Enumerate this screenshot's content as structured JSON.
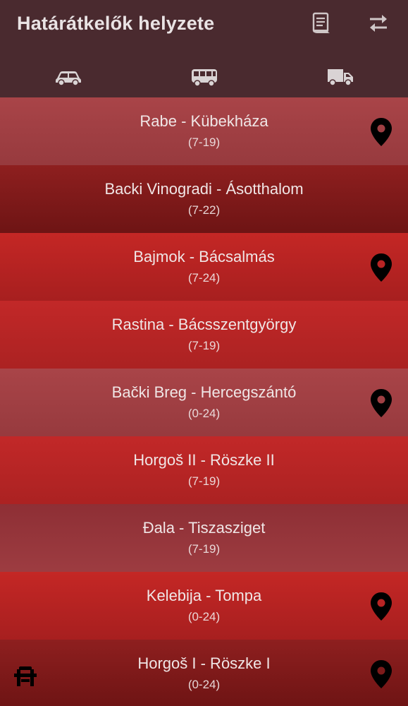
{
  "app": {
    "title": "Határátkelők helyzete"
  },
  "toolbar": {
    "icons": [
      "document-icon",
      "swap-icon"
    ]
  },
  "tabs": [
    {
      "icon": "car-icon"
    },
    {
      "icon": "bus-icon"
    },
    {
      "icon": "truck-icon"
    }
  ],
  "crossings": [
    {
      "name": "Rabe - Kübekháza",
      "hours": "(7-19)",
      "pin": true,
      "style": "g-light"
    },
    {
      "name": "Backi Vinogradi - Ásotthalom",
      "hours": "(7-22)",
      "pin": false,
      "style": "g-dark"
    },
    {
      "name": "Bajmok - Bácsalmás",
      "hours": "(7-24)",
      "pin": true,
      "style": "g-red"
    },
    {
      "name": "Rastina - Bácsszentgyörgy",
      "hours": "(7-19)",
      "pin": false,
      "style": "g-red2"
    },
    {
      "name": "Bački Breg - Hercegszántó",
      "hours": "(0-24)",
      "pin": true,
      "style": "g-light"
    },
    {
      "name": "Horgoš II - Röszke II",
      "hours": "(7-19)",
      "pin": false,
      "style": "g-red2"
    },
    {
      "name": "Đala - Tiszasziget",
      "hours": "(7-19)",
      "pin": false,
      "style": "g-mauve"
    },
    {
      "name": "Kelebija - Tompa",
      "hours": "(0-24)",
      "pin": true,
      "style": "g-red"
    },
    {
      "name": "Horgoš I - Röszke I",
      "hours": "(0-24)",
      "pin": true,
      "style": "g-dark"
    }
  ],
  "bottom": {
    "icon": "road-icon"
  },
  "colors": {
    "appbar": "#4a2a2f",
    "text": "#f0e6e6",
    "pin": "#000000"
  }
}
